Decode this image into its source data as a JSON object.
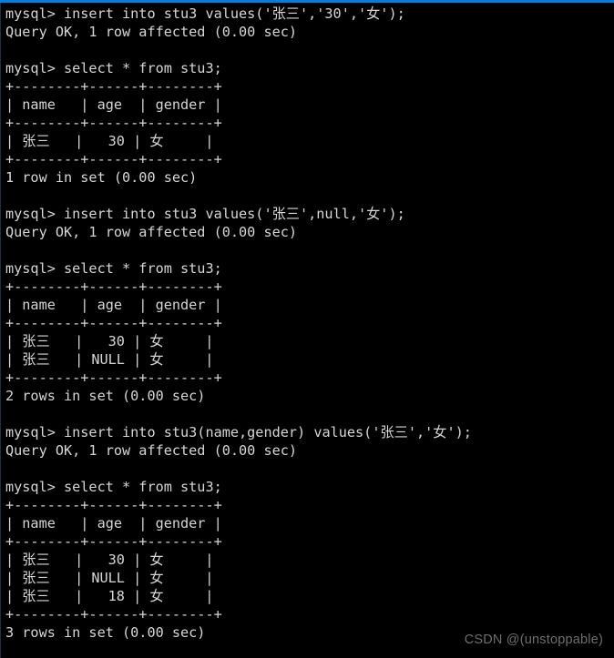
{
  "terminal": {
    "prompt": "mysql>",
    "top_border_color": "#0a7cd4",
    "background_color": "#000000",
    "text_color": "#d6d6d6",
    "lines": [
      "mysql> insert into stu3 values('张三','30','女');",
      "Query OK, 1 row affected (0.00 sec)",
      "",
      "mysql> select * from stu3;",
      "+--------+------+--------+",
      "| name   | age  | gender |",
      "+--------+------+--------+",
      "| 张三   |   30 | 女     |",
      "+--------+------+--------+",
      "1 row in set (0.00 sec)",
      "",
      "mysql> insert into stu3 values('张三',null,'女');",
      "Query OK, 1 row affected (0.00 sec)",
      "",
      "mysql> select * from stu3;",
      "+--------+------+--------+",
      "| name   | age  | gender |",
      "+--------+------+--------+",
      "| 张三   |   30 | 女     |",
      "| 张三   | NULL | 女     |",
      "+--------+------+--------+",
      "2 rows in set (0.00 sec)",
      "",
      "mysql> insert into stu3(name,gender) values('张三','女');",
      "Query OK, 1 row affected (0.00 sec)",
      "",
      "mysql> select * from stu3;",
      "+--------+------+--------+",
      "| name   | age  | gender |",
      "+--------+------+--------+",
      "| 张三   |   30 | 女     |",
      "| 张三   | NULL | 女     |",
      "| 张三   |   18 | 女     |",
      "+--------+------+--------+",
      "3 rows in set (0.00 sec)"
    ],
    "commands": [
      "insert into stu3 values('张三','30','女');",
      "select * from stu3;",
      "insert into stu3 values('张三',null,'女');",
      "select * from stu3;",
      "insert into stu3(name,gender) values('张三','女');",
      "select * from stu3;"
    ],
    "status_messages": [
      "Query OK, 1 row affected (0.00 sec)",
      "1 row in set (0.00 sec)",
      "Query OK, 1 row affected (0.00 sec)",
      "2 rows in set (0.00 sec)",
      "Query OK, 1 row affected (0.00 sec)",
      "3 rows in set (0.00 sec)"
    ],
    "result_tables": [
      {
        "columns": [
          "name",
          "age",
          "gender"
        ],
        "rows": [
          [
            "张三",
            "30",
            "女"
          ]
        ],
        "row_count_text": "1 row in set (0.00 sec)"
      },
      {
        "columns": [
          "name",
          "age",
          "gender"
        ],
        "rows": [
          [
            "张三",
            "30",
            "女"
          ],
          [
            "张三",
            "NULL",
            "女"
          ]
        ],
        "row_count_text": "2 rows in set (0.00 sec)"
      },
      {
        "columns": [
          "name",
          "age",
          "gender"
        ],
        "rows": [
          [
            "张三",
            "30",
            "女"
          ],
          [
            "张三",
            "NULL",
            "女"
          ],
          [
            "张三",
            "18",
            "女"
          ]
        ],
        "row_count_text": "3 rows in set (0.00 sec)"
      }
    ]
  },
  "watermark": {
    "text": "CSDN @(unstoppable)",
    "color": "#6e6e6e"
  }
}
